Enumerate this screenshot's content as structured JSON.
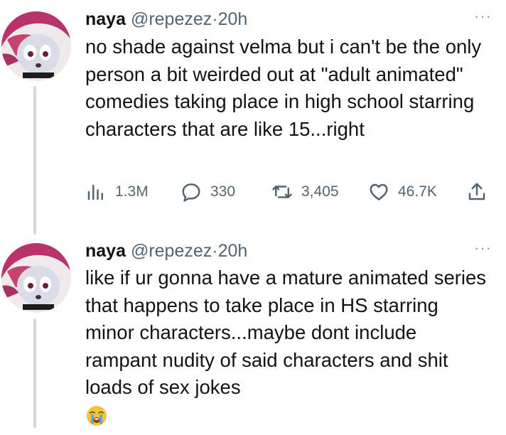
{
  "tweets": [
    {
      "name": "naya",
      "handle": "@repezez",
      "separator": "·",
      "time": "20h",
      "more": "···",
      "text": "no shade against velma but i can't be the only person a bit weirded out at \"adult animated\" comedies taking place in high school starring characters that are like 15...right",
      "stats": {
        "views": "1.3M",
        "replies": "330",
        "retweets": "3,405",
        "likes": "46.7K"
      },
      "icons": [
        "views-icon",
        "reply-icon",
        "retweet-icon",
        "like-icon",
        "share-icon"
      ]
    },
    {
      "name": "naya",
      "handle": "@repezez",
      "separator": "·",
      "time": "20h",
      "more": "···",
      "text": "like if ur gonna have a mature animated series that happens to take place in HS starring minor characters...maybe dont include rampant nudity of said characters and shit loads of sex jokes",
      "emoji": "loudly-crying-face-emoji"
    }
  ],
  "colors": {
    "text": "#0f1419",
    "secondary": "#536471",
    "thread_line": "#cfd9de",
    "avatar_hair": "#b8326b"
  }
}
